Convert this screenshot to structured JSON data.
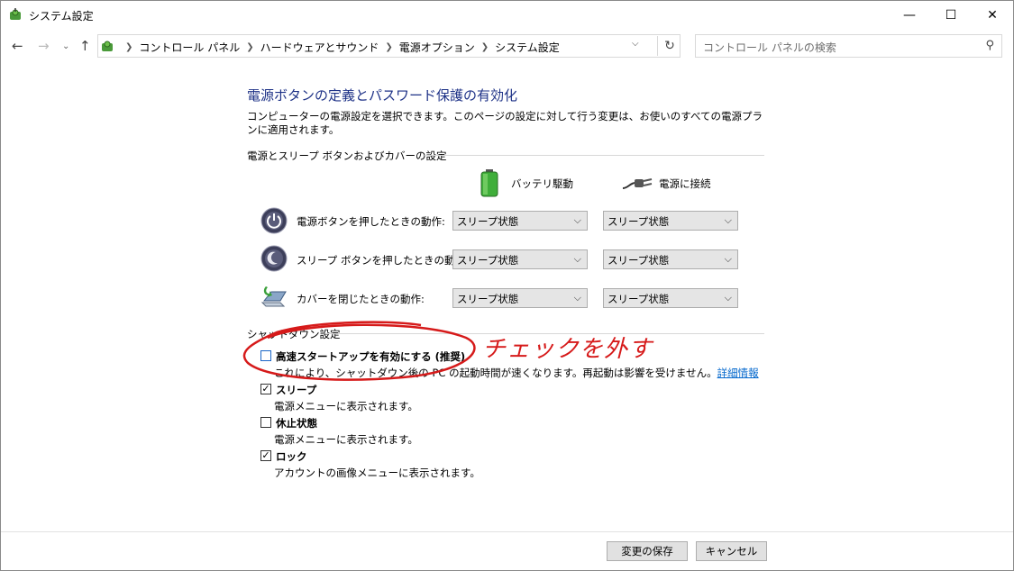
{
  "window": {
    "title": "システム設定",
    "controls": {
      "minimize": "—",
      "maximize": "☐",
      "close": "✕"
    }
  },
  "nav": {
    "back": "←",
    "forward": "→",
    "recent": "⌄",
    "up": "↑",
    "breadcrumb": [
      "コントロール パネル",
      "ハードウェアとサウンド",
      "電源オプション",
      "システム設定"
    ],
    "search_placeholder": "コントロール パネルの検索"
  },
  "page": {
    "heading": "電源ボタンの定義とパスワード保護の有効化",
    "description": "コンピューターの電源設定を選択できます。このページの設定に対して行う変更は、お使いのすべての電源プランに適用されます。",
    "power_group": {
      "label": "電源とスリープ ボタンおよびカバーの設定",
      "battery_header": "バッテリ駆動",
      "plugged_header": "電源に接続",
      "rows": [
        {
          "icon": "power-button-icon",
          "label": "電源ボタンを押したときの動作:",
          "battery": "スリープ状態",
          "plugged": "スリープ状態"
        },
        {
          "icon": "sleep-button-icon",
          "label": "スリープ ボタンを押したときの動作:",
          "battery": "スリープ状態",
          "plugged": "スリープ状態"
        },
        {
          "icon": "laptop-lid-icon",
          "label": "カバーを閉じたときの動作:",
          "battery": "スリープ状態",
          "plugged": "スリープ状態"
        }
      ]
    },
    "shutdown_group": {
      "label": "シャットダウン設定",
      "items": [
        {
          "label": "高速スタートアップを有効にする (推奨)",
          "checked": false,
          "desc": "これにより、シャットダウン後の PC の起動時間が速くなります。再起動は影響を受けません。",
          "link": "詳細情報"
        },
        {
          "label": "スリープ",
          "checked": true,
          "desc": "電源メニューに表示されます。"
        },
        {
          "label": "休止状態",
          "checked": false,
          "desc": "電源メニューに表示されます。"
        },
        {
          "label": "ロック",
          "checked": true,
          "desc": "アカウントの画像メニューに表示されます。"
        }
      ]
    },
    "annotation": "チェックを外す"
  },
  "footer": {
    "save": "変更の保存",
    "cancel": "キャンセル"
  },
  "colors": {
    "heading": "#1e3287",
    "link": "#0066cc",
    "annotation": "#d61a1a"
  }
}
